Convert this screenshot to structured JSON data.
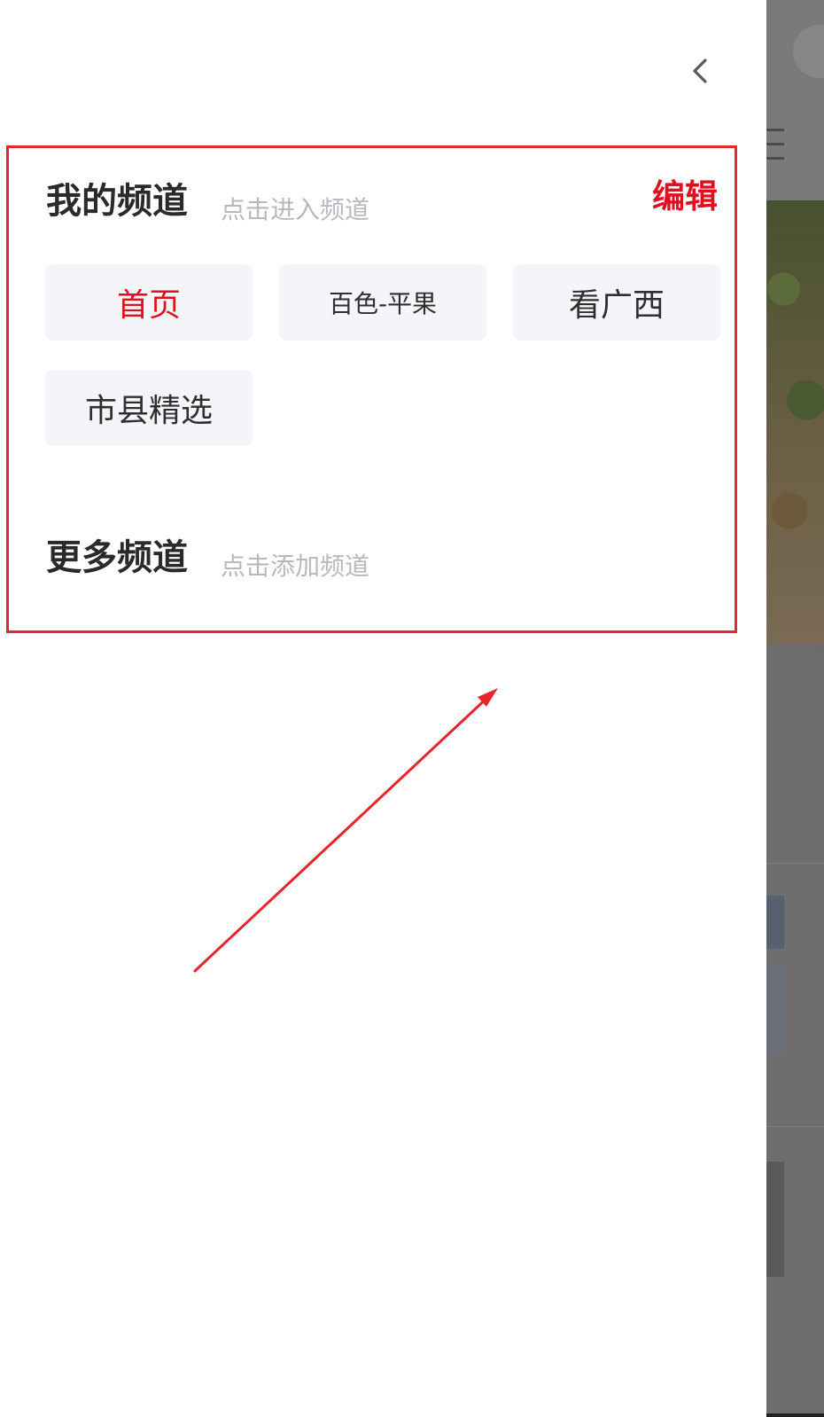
{
  "my_channels": {
    "title": "我的频道",
    "hint": "点击进入频道",
    "edit_label": "编辑",
    "items": [
      {
        "label": "首页",
        "active": true
      },
      {
        "label": "百色-平果",
        "active": false
      },
      {
        "label": "看广西",
        "active": false
      },
      {
        "label": "市县精选",
        "active": false
      }
    ]
  },
  "more_channels": {
    "title": "更多频道",
    "hint": "点击添加频道"
  },
  "icons": {
    "back": "chevron-left-icon"
  },
  "colors": {
    "accent": "#e2101f",
    "annotation": "#e8262a",
    "chip_background": "#f4f5f8",
    "hint_text": "#b8b8bf"
  }
}
